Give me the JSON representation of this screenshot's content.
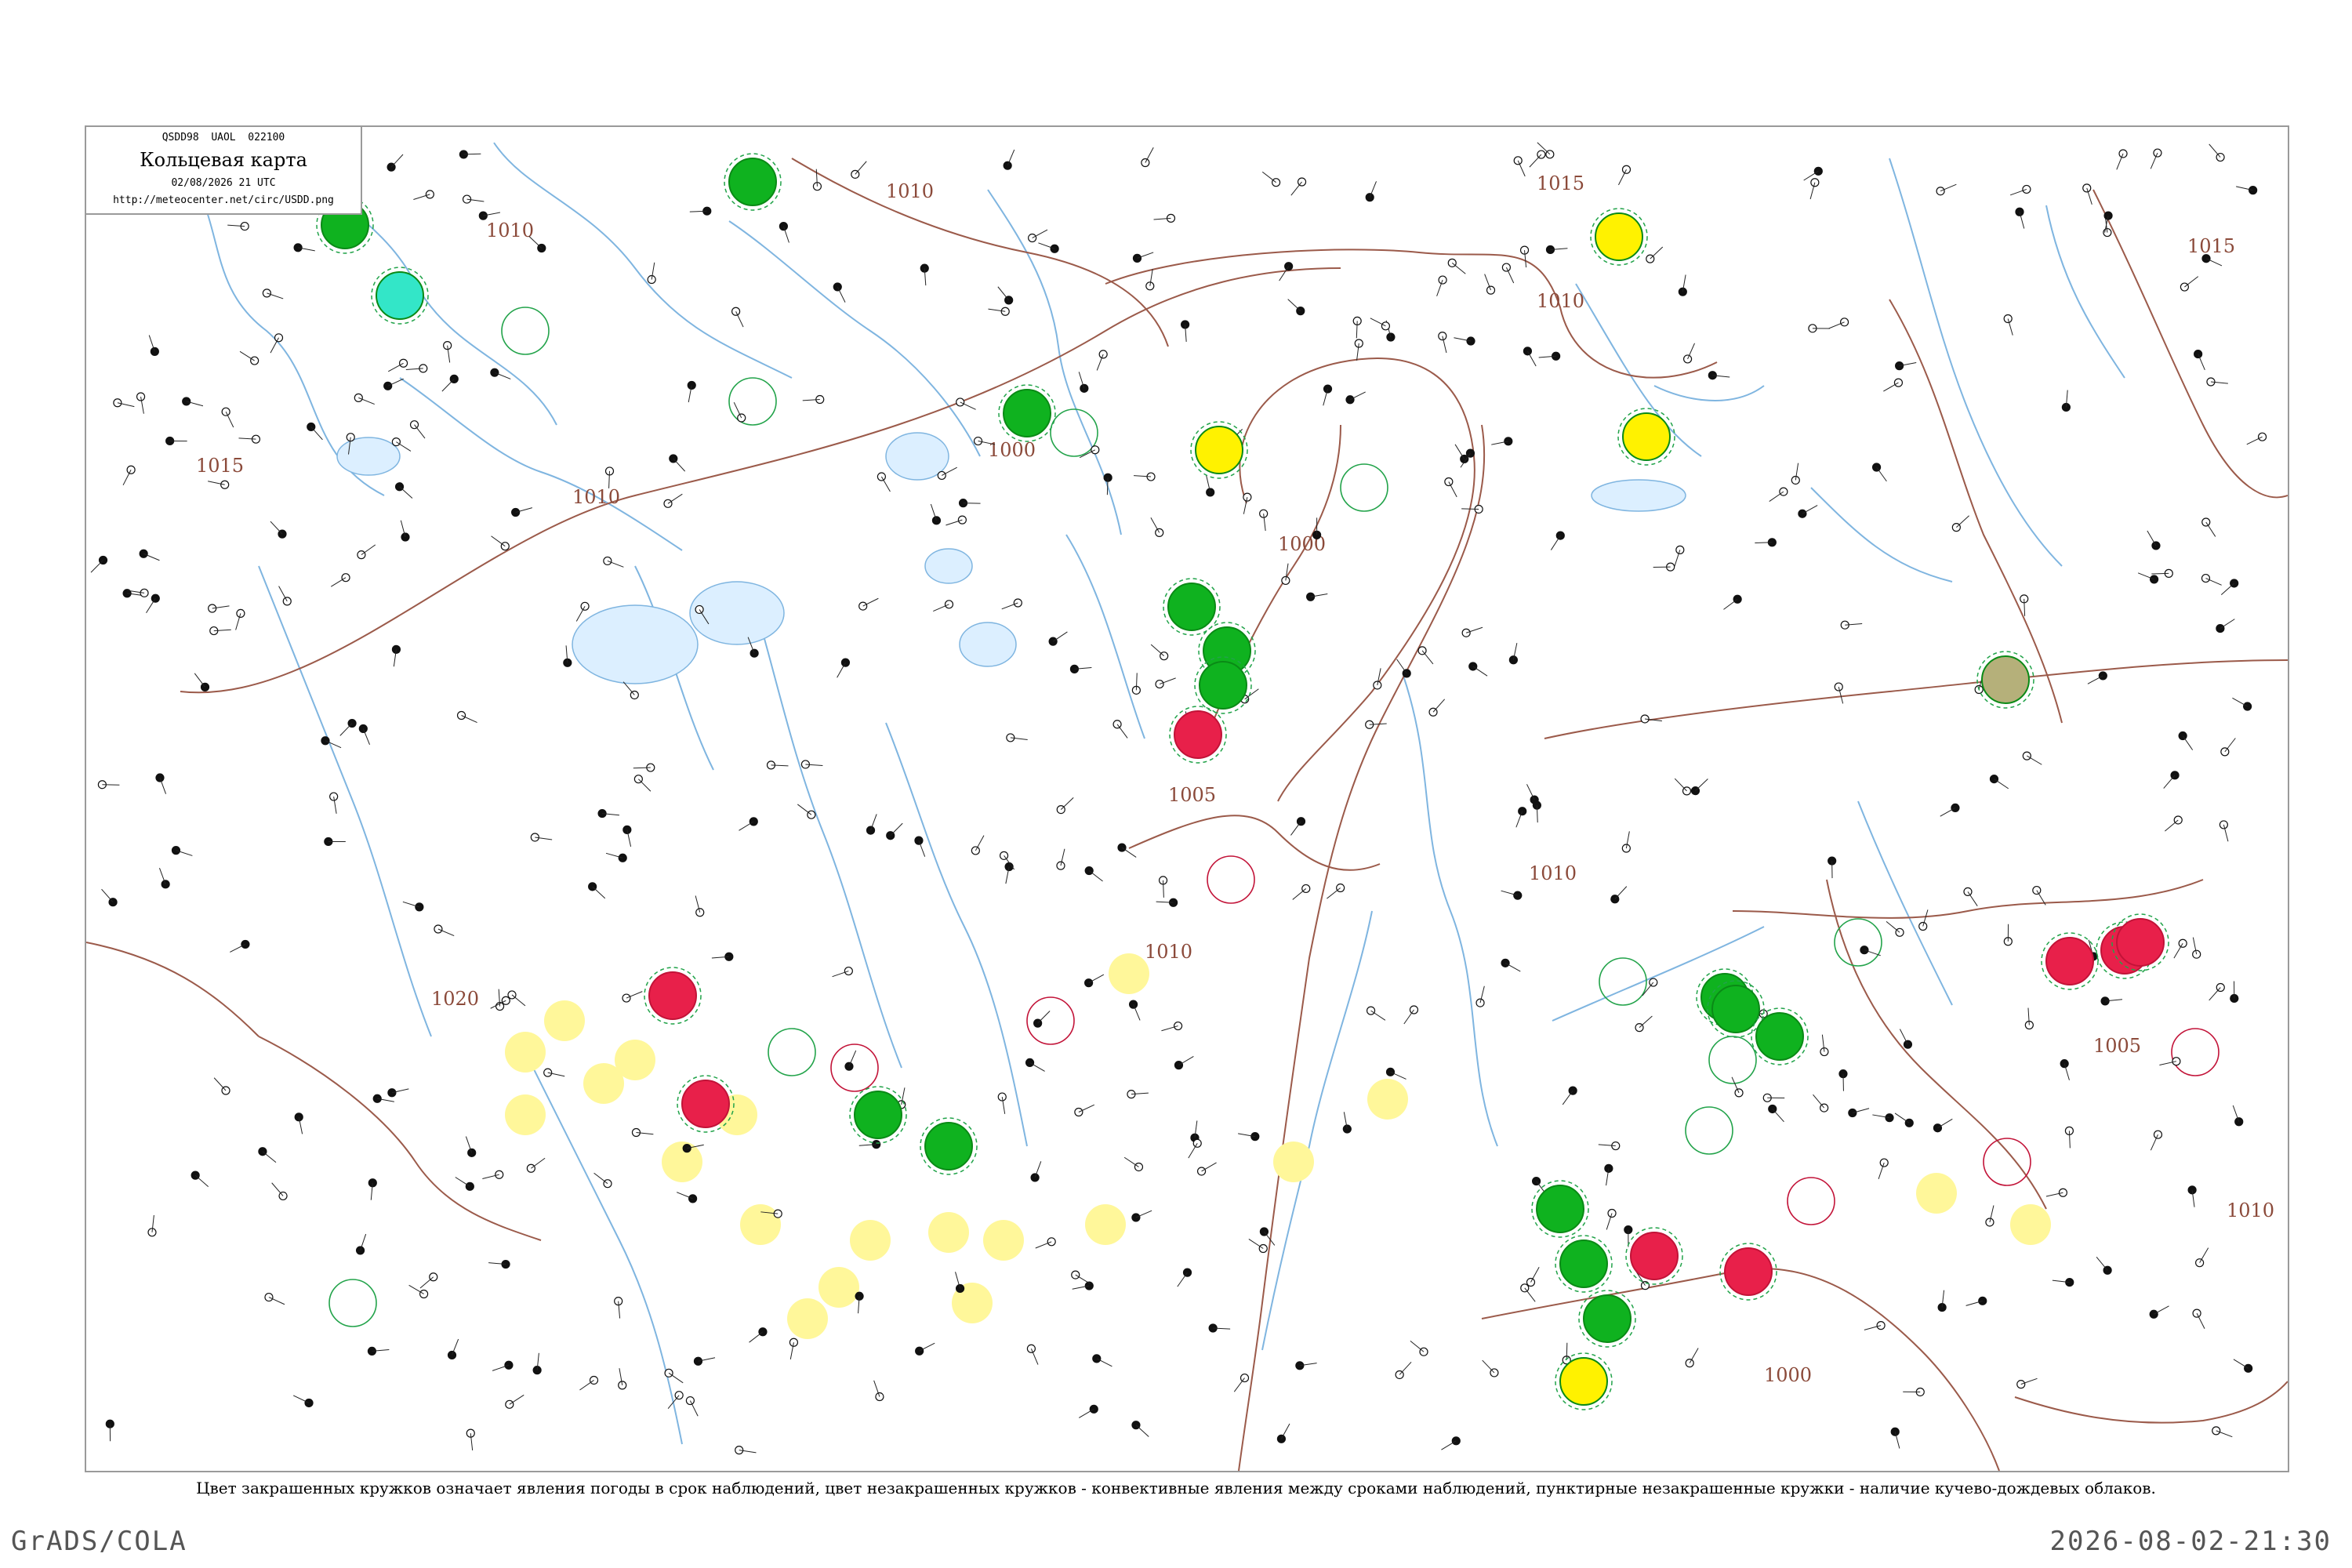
{
  "header": {
    "code_line": "QSDD98  UAOL  022100",
    "title": "Кольцевая карта",
    "timestamp": "02/08/2026 21 UTC",
    "url": "http://meteocenter.net/circ/USDD.png"
  },
  "caption": "Цвет закрашенных кружков означает явления погоды в срок наблюдений, цвет незакрашенных кружков - конвективные явления между сроками наблюдений, пунктирные незакрашенные кружки - наличие кучево-дождевых облаков.",
  "footer": {
    "left": "GrADS/COLA",
    "right": "2026-08-02-21:30"
  },
  "colors": {
    "isobar": "#9b5a4a",
    "water": "#7fb5e0",
    "green_fill": "#0fb21f",
    "yellow_fill": "#fff200",
    "pale_yellow_fill": "#fff79a",
    "red_fill": "#e8204a",
    "cyan_fill": "#33e6c8",
    "olive_fill": "#b5b07a"
  },
  "isobar_labels": [
    {
      "text": "1010"
    },
    {
      "text": "1010"
    },
    {
      "text": "1015"
    },
    {
      "text": "1015"
    },
    {
      "text": "1010"
    },
    {
      "text": "1000"
    },
    {
      "text": "1005"
    },
    {
      "text": "1010"
    },
    {
      "text": "1010"
    },
    {
      "text": "1020"
    },
    {
      "text": "1015"
    },
    {
      "text": "1000"
    },
    {
      "text": "1010"
    },
    {
      "text": "1005"
    },
    {
      "text": "1000"
    },
    {
      "text": "1010"
    }
  ],
  "station_markers": [
    {
      "type": "filled",
      "color": "green"
    },
    {
      "type": "filled",
      "color": "green"
    },
    {
      "type": "filled",
      "color": "cyan"
    },
    {
      "type": "filled",
      "color": "green"
    },
    {
      "type": "filled",
      "color": "yellow"
    },
    {
      "type": "filled",
      "color": "green"
    },
    {
      "type": "filled",
      "color": "green"
    },
    {
      "type": "filled",
      "color": "green"
    },
    {
      "type": "filled",
      "color": "red"
    },
    {
      "type": "filled",
      "color": "yellow"
    },
    {
      "type": "filled",
      "color": "yellow"
    },
    {
      "type": "filled",
      "color": "olive"
    },
    {
      "type": "filled",
      "color": "red"
    },
    {
      "type": "filled",
      "color": "green"
    },
    {
      "type": "filled",
      "color": "red"
    },
    {
      "type": "filled",
      "color": "red"
    },
    {
      "type": "filled",
      "color": "green"
    },
    {
      "type": "filled",
      "color": "green"
    },
    {
      "type": "filled",
      "color": "green"
    },
    {
      "type": "filled",
      "color": "green"
    },
    {
      "type": "filled",
      "color": "green"
    },
    {
      "type": "filled",
      "color": "green"
    },
    {
      "type": "filled",
      "color": "green"
    },
    {
      "type": "filled",
      "color": "red"
    },
    {
      "type": "filled",
      "color": "red"
    },
    {
      "type": "filled",
      "color": "yellow"
    },
    {
      "type": "filled",
      "color": "red"
    },
    {
      "type": "filled",
      "color": "red"
    }
  ]
}
